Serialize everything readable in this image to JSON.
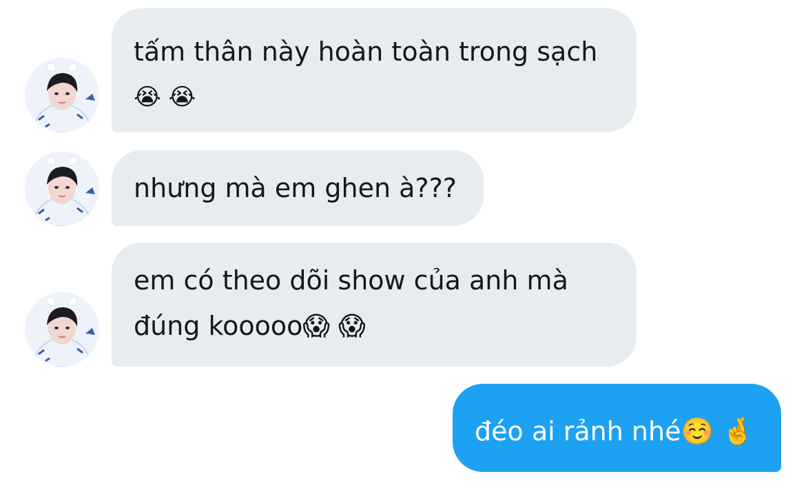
{
  "conversation": {
    "messages": [
      {
        "sender": "other",
        "lines": [
          "tấm thân này hoàn toàn trong sạch",
          "😭 😭"
        ]
      },
      {
        "sender": "other",
        "lines": [
          "nhưng mà em ghen à???"
        ]
      },
      {
        "sender": "other",
        "lines": [
          "em có theo dõi show của anh mà",
          "đúng kooooo😱 😱"
        ]
      },
      {
        "sender": "self",
        "lines": [
          "đéo ai rảnh nhé☺️ 🤞"
        ]
      }
    ]
  },
  "avatar": {
    "icon": "profile-photo-icon",
    "colors": {
      "background": "#f4f7fb",
      "hair": "#1b1b22",
      "skin": "#f1d7cf",
      "shirt": "#eef3fb",
      "accent": "#3a5ea8"
    }
  },
  "colors": {
    "incoming_bubble": "#e6ecf0",
    "outgoing_bubble": "#1da1f2",
    "incoming_text": "#14171a",
    "outgoing_text": "#ffffff"
  }
}
